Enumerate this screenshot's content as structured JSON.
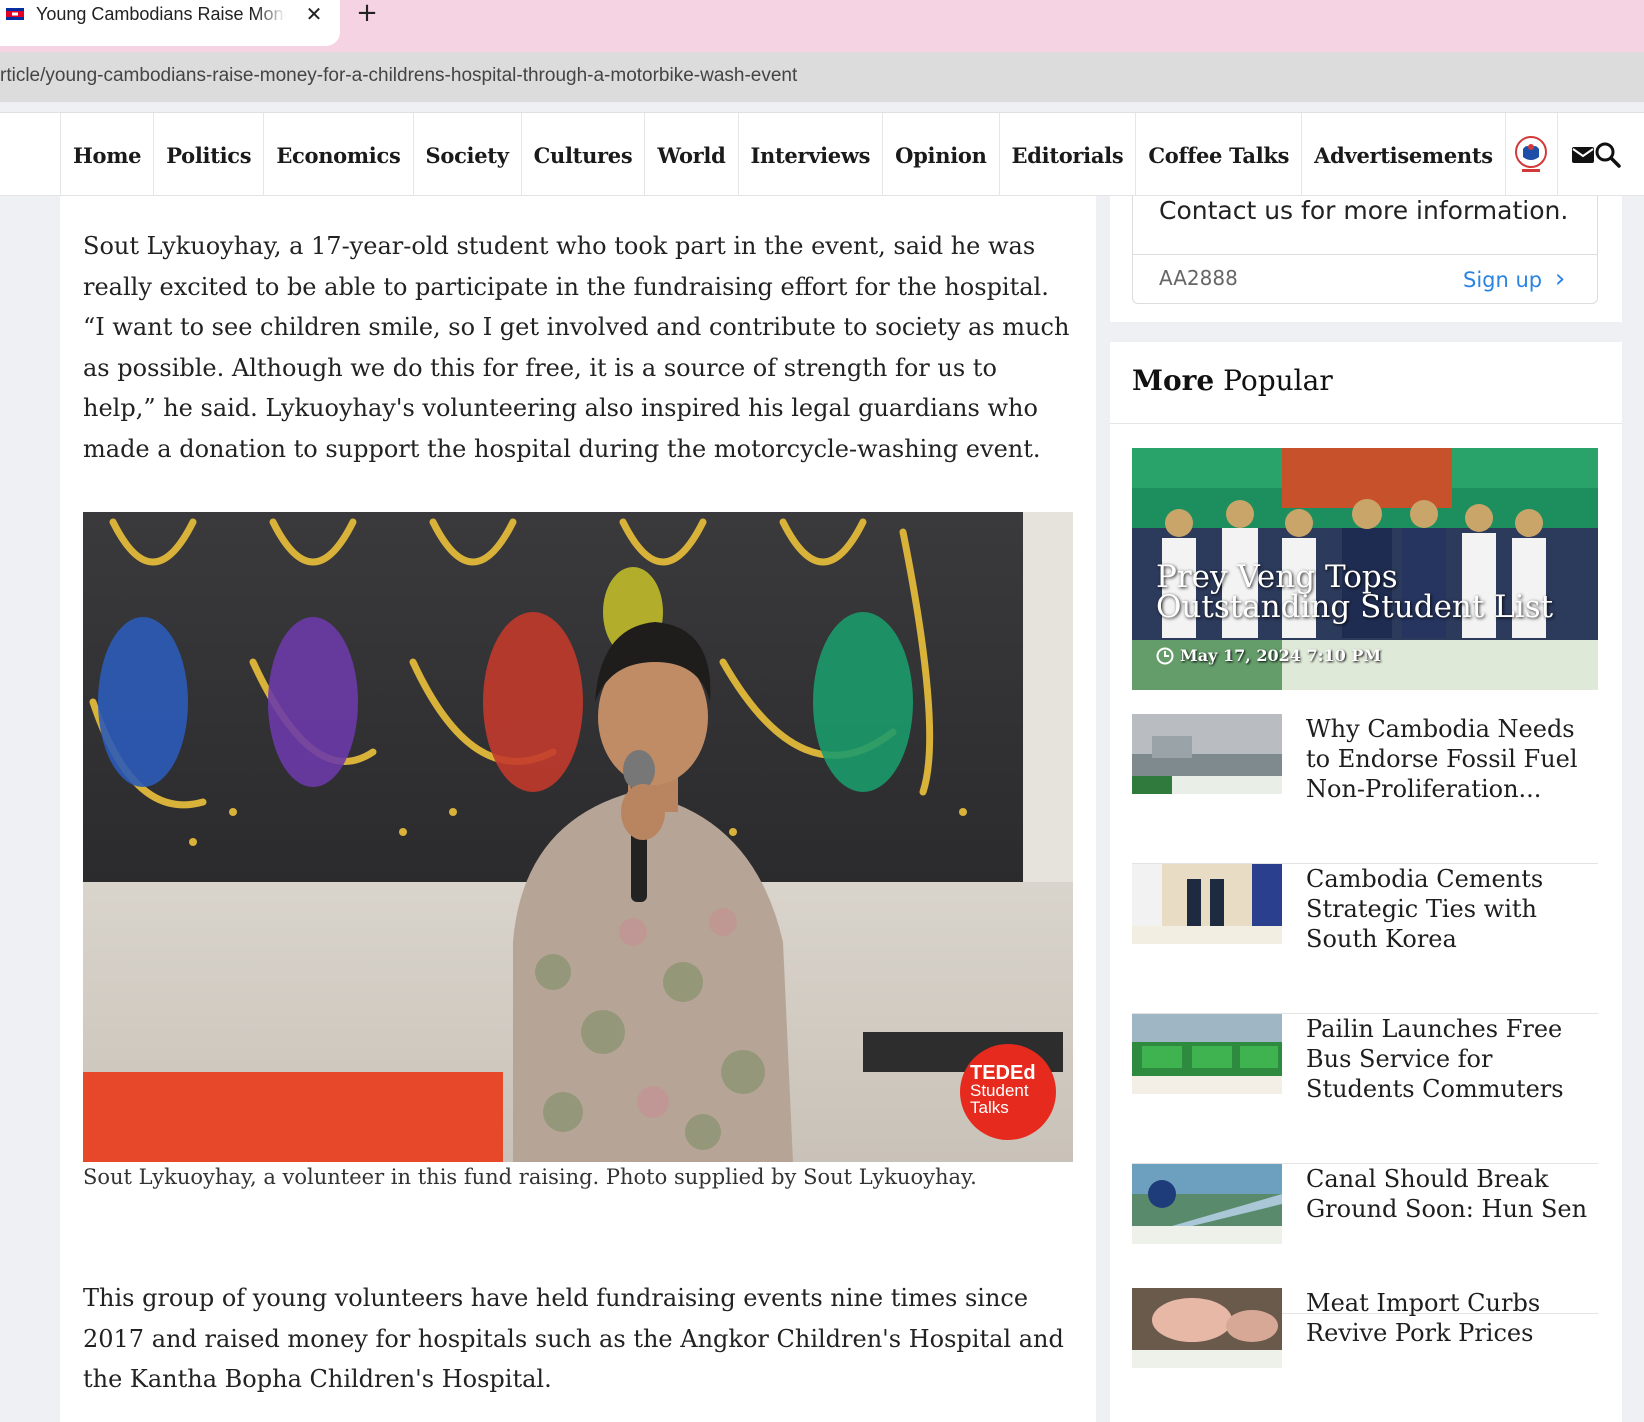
{
  "browser": {
    "tab_title": "Young Cambodians Raise Money for a Children's Hospital",
    "tab_close": "✕",
    "new_tab": "+",
    "url": "rticle/young-cambodians-raise-money-for-a-childrens-hospital-through-a-motorbike-wash-event"
  },
  "nav": {
    "items": [
      "Home",
      "Politics",
      "Economics",
      "Society",
      "Cultures",
      "World",
      "Interviews",
      "Opinion",
      "Editorials",
      "Coffee Talks",
      "Advertisements"
    ],
    "icons": [
      "khmer-logo-icon",
      "mail-icon",
      "search-icon"
    ]
  },
  "article": {
    "para1": "Sout Lykuoyhay, a 17-year-old student who took part in the event, said he was really excited to be able to participate in the fundraising effort for the hospital. “I want to see children smile, so I get involved and contribute to society as much as possible. Although we do this for free, it is a source of strength for us to help,” he said. Lykuoyhay's volunteering also inspired his legal guardians who made a donation to support the hospital during the motorcycle-washing event.",
    "photo_badge": [
      "TED",
      "Ed",
      "Student",
      "Talks"
    ],
    "caption": "Sout Lykuoyhay, a volunteer in this fund raising. Photo supplied by Sout Lykuoyhay.",
    "para2": "This group of young volunteers have held fundraising events nine times since 2017 and raised money for hospitals such as the Angkor Children's Hospital and the Kantha Bopha Children's Hospital."
  },
  "sidebar": {
    "contact_text": "Contact us for more information.",
    "code": "AA2888",
    "signup_label": "Sign up",
    "signup_chevron": "›",
    "popular_bold": "More",
    "popular_rest": " Popular",
    "feature": {
      "title": "Prey Veng Tops Outstanding Student List",
      "date": "May 17, 2024 7:10 PM"
    },
    "items": [
      {
        "title": "Why Cambodia Needs to Endorse Fossil Fuel Non-Proliferation..."
      },
      {
        "title": "Cambodia Cements Strategic Ties with South Korea"
      },
      {
        "title": "Pailin Launches Free Bus Service for Students Commuters"
      },
      {
        "title": "Canal Should Break Ground Soon: Hun Sen"
      },
      {
        "title": "Meat Import Curbs Revive Pork Prices"
      }
    ]
  },
  "colors": {
    "tab_strip": "#f6d3e2",
    "link_blue": "#2a84e0",
    "ted_red": "#e62b1e"
  }
}
